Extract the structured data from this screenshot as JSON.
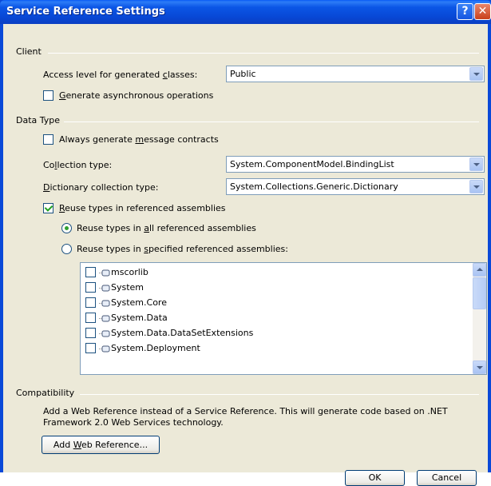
{
  "window": {
    "title": "Service Reference Settings",
    "help_icon": "?",
    "close_icon": "✕"
  },
  "client_group": {
    "label": "Client",
    "access_level": {
      "label_pre": "Access level for generated ",
      "label_accel": "c",
      "label_post": "lasses:",
      "value": "Public"
    },
    "async": {
      "label_accel": "G",
      "label_post": "enerate asynchronous operations",
      "checked": false
    }
  },
  "data_type_group": {
    "label": "Data Type",
    "message_contracts": {
      "label_pre": "Always generate ",
      "label_accel": "m",
      "label_post": "essage contracts",
      "checked": false
    },
    "collection_type": {
      "label_pre": "Co",
      "label_accel": "l",
      "label_post": "lection type:",
      "value": "System.ComponentModel.BindingList"
    },
    "dictionary_type": {
      "label_accel": "D",
      "label_post": "ictionary collection type:",
      "value": "System.Collections.Generic.Dictionary"
    },
    "reuse_types": {
      "label_accel": "R",
      "label_post": "euse types in referenced assemblies",
      "checked": true
    },
    "reuse_all": {
      "label_pre": "Reuse types in ",
      "label_accel": "a",
      "label_post": "ll referenced assemblies",
      "selected": true
    },
    "reuse_specified": {
      "label_pre": "Reuse types in ",
      "label_accel": "s",
      "label_post": "pecified referenced assemblies:",
      "selected": false
    },
    "assemblies": [
      {
        "name": "mscorlib",
        "checked": false
      },
      {
        "name": "System",
        "checked": false
      },
      {
        "name": "System.Core",
        "checked": false
      },
      {
        "name": "System.Data",
        "checked": false
      },
      {
        "name": "System.Data.DataSetExtensions",
        "checked": false
      },
      {
        "name": "System.Deployment",
        "checked": false
      }
    ]
  },
  "compatibility_group": {
    "label": "Compatibility",
    "description": "Add a Web Reference instead of a Service Reference. This will generate code based on .NET Framework 2.0 Web Services technology.",
    "description_line1": "Add a Web Reference instead of a Service Reference. This will generate code based on .NET",
    "description_line2": "Framework 2.0 Web Services technology.",
    "add_web_ref": {
      "label_pre": "Add ",
      "label_accel": "W",
      "label_post": "eb Reference..."
    }
  },
  "footer": {
    "ok_label": "OK",
    "cancel_label": "Cancel"
  },
  "colors": {
    "title_bar": "#0a49d8",
    "dialog_bg": "#ece9d8",
    "check_green": "#21a121"
  }
}
